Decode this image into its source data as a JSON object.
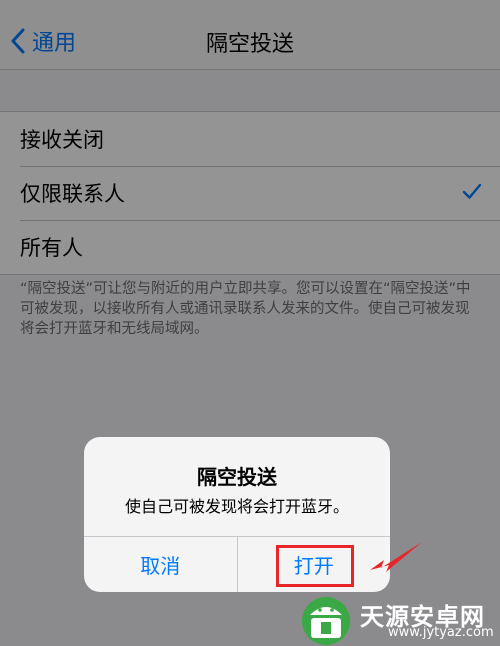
{
  "nav": {
    "back_label": "通用",
    "title": "隔空投送"
  },
  "options": [
    {
      "label": "接收关闭",
      "selected": false
    },
    {
      "label": "仅限联系人",
      "selected": true
    },
    {
      "label": "所有人",
      "selected": false
    }
  ],
  "footer_note": "“隔空投送”可让您与附近的用户立即共享。您可以设置在“隔空投送”中可被发现，以接收所有人或通讯录联系人发来的文件。使自己可被发现将会打开蓝牙和无线局域网。",
  "alert": {
    "title": "隔空投送",
    "message": "使自己可被发现将会打开蓝牙。",
    "cancel_label": "取消",
    "confirm_label": "打开"
  },
  "watermark": {
    "name": "天源安卓网",
    "url": "www.jytyaz.com"
  },
  "colors": {
    "accent": "#007aff",
    "annotation": "#e8262a",
    "watermark_green": "#3aa845"
  }
}
